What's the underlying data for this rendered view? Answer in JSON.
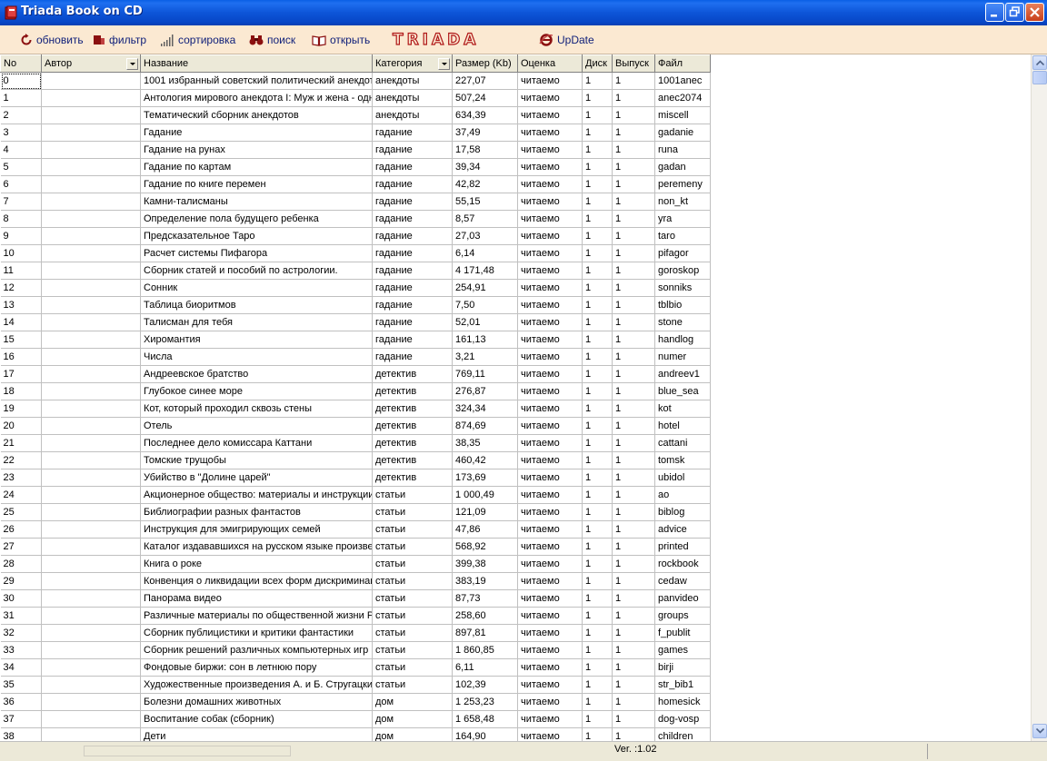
{
  "window": {
    "title": "Triada Book on CD"
  },
  "toolbar": {
    "refresh_label": "обновить",
    "filter_label": "фильтр",
    "sort_label": "сортировка",
    "search_label": "поиск",
    "open_label": "открыть",
    "logo_text": "TRIADA",
    "update_label": "UpDate"
  },
  "colors": {
    "titlebar": "#0a5fe6",
    "toolbar_bg": "#fbe9d2",
    "logo": "#b01818",
    "toolbar_text": "#10207a"
  },
  "table": {
    "columns": [
      "No",
      "Автор",
      "Название",
      "Категория",
      "Размер (Kb)",
      "Оценка",
      "Диск",
      "Выпуск",
      "Файл"
    ],
    "rows": [
      [
        "0",
        "",
        "1001 избранный советский политический анекдот",
        "анекдоты",
        "227,07",
        "читаемо",
        "1",
        "1",
        "1001anec"
      ],
      [
        "1",
        "",
        "Антология мирового анекдота I: Муж и жена - одна сатана",
        "анекдоты",
        "507,24",
        "читаемо",
        "1",
        "1",
        "anec2074"
      ],
      [
        "2",
        "",
        "Тематический сборник анекдотов",
        "анекдоты",
        "634,39",
        "читаемо",
        "1",
        "1",
        "miscell"
      ],
      [
        "3",
        "",
        "Гадание",
        "гадание",
        "37,49",
        "читаемо",
        "1",
        "1",
        "gadanie"
      ],
      [
        "4",
        "",
        "Гадание на рунах",
        "гадание",
        "17,58",
        "читаемо",
        "1",
        "1",
        "runa"
      ],
      [
        "5",
        "",
        "Гадание по картам",
        "гадание",
        "39,34",
        "читаемо",
        "1",
        "1",
        "gadan"
      ],
      [
        "6",
        "",
        "Гадание по книге перемен",
        "гадание",
        "42,82",
        "читаемо",
        "1",
        "1",
        "peremeny"
      ],
      [
        "7",
        "",
        "Камни-талисманы",
        "гадание",
        "55,15",
        "читаемо",
        "1",
        "1",
        "non_kt"
      ],
      [
        "8",
        "",
        "Определение пола будущего ребенка",
        "гадание",
        "8,57",
        "читаемо",
        "1",
        "1",
        "yra"
      ],
      [
        "9",
        "",
        "Предсказательное Таро",
        "гадание",
        "27,03",
        "читаемо",
        "1",
        "1",
        "taro"
      ],
      [
        "10",
        "",
        "Расчет системы Пифагора",
        "гадание",
        "6,14",
        "читаемо",
        "1",
        "1",
        "pifagor"
      ],
      [
        "11",
        "",
        "Сборник статей и пособий по астрологии.",
        "гадание",
        "4 171,48",
        "читаемо",
        "1",
        "1",
        "goroskop"
      ],
      [
        "12",
        "",
        "Сонник",
        "гадание",
        "254,91",
        "читаемо",
        "1",
        "1",
        "sonniks"
      ],
      [
        "13",
        "",
        "Таблица биоритмов",
        "гадание",
        "7,50",
        "читаемо",
        "1",
        "1",
        "tblbio"
      ],
      [
        "14",
        "",
        "Талисман для тебя",
        "гадание",
        "52,01",
        "читаемо",
        "1",
        "1",
        "stone"
      ],
      [
        "15",
        "",
        "Хиромантия",
        "гадание",
        "161,13",
        "читаемо",
        "1",
        "1",
        "handlog"
      ],
      [
        "16",
        "",
        "Числа",
        "гадание",
        "3,21",
        "читаемо",
        "1",
        "1",
        "numer"
      ],
      [
        "17",
        "",
        "Андреевское братство",
        "детектив",
        "769,11",
        "читаемо",
        "1",
        "1",
        "andreev1"
      ],
      [
        "18",
        "",
        "Глубокое синее море",
        "детектив",
        "276,87",
        "читаемо",
        "1",
        "1",
        "blue_sea"
      ],
      [
        "19",
        "",
        "Кот, который проходил сквозь стены",
        "детектив",
        "324,34",
        "читаемо",
        "1",
        "1",
        "kot"
      ],
      [
        "20",
        "",
        "Отель",
        "детектив",
        "874,69",
        "читаемо",
        "1",
        "1",
        "hotel"
      ],
      [
        "21",
        "",
        "Последнее дело комиссара Каттани",
        "детектив",
        "38,35",
        "читаемо",
        "1",
        "1",
        "cattani"
      ],
      [
        "22",
        "",
        "Томские трущобы",
        "детектив",
        "460,42",
        "читаемо",
        "1",
        "1",
        "tomsk"
      ],
      [
        "23",
        "",
        "Убийство в \"Долине царей\"",
        "детектив",
        "173,69",
        "читаемо",
        "1",
        "1",
        "ubidol"
      ],
      [
        "24",
        "",
        "Акционерное общество: материалы и инструкции",
        "статьи",
        "1 000,49",
        "читаемо",
        "1",
        "1",
        "ao"
      ],
      [
        "25",
        "",
        "Библиографии разных фантастов",
        "статьи",
        "121,09",
        "читаемо",
        "1",
        "1",
        "biblog"
      ],
      [
        "26",
        "",
        "Инструкция для эмигрирующих семей",
        "статьи",
        "47,86",
        "читаемо",
        "1",
        "1",
        "advice"
      ],
      [
        "27",
        "",
        "Каталог издававшихся на русском языке произведений",
        "статьи",
        "568,92",
        "читаемо",
        "1",
        "1",
        "printed"
      ],
      [
        "28",
        "",
        "Книга о роке",
        "статьи",
        "399,38",
        "читаемо",
        "1",
        "1",
        "rockbook"
      ],
      [
        "29",
        "",
        "Конвенция о ликвидации всех форм дискриминации",
        "статьи",
        "383,19",
        "читаемо",
        "1",
        "1",
        "cedaw"
      ],
      [
        "30",
        "",
        "Панорама видео",
        "статьи",
        "87,73",
        "читаемо",
        "1",
        "1",
        "panvideo"
      ],
      [
        "31",
        "",
        "Различные материалы по общественной жизни России",
        "статьи",
        "258,60",
        "читаемо",
        "1",
        "1",
        "groups"
      ],
      [
        "32",
        "",
        "Сборник публицистики и критики фантастики",
        "статьи",
        "897,81",
        "читаемо",
        "1",
        "1",
        "f_publit"
      ],
      [
        "33",
        "",
        "Сборник решений различных компьютерных игр и",
        "статьи",
        "1 860,85",
        "читаемо",
        "1",
        "1",
        "games"
      ],
      [
        "34",
        "",
        "Фондовые биржи: сон в летнюю пору",
        "статьи",
        "6,11",
        "читаемо",
        "1",
        "1",
        "birji"
      ],
      [
        "35",
        "",
        "Художественные произведения А. и Б. Стругацких",
        "статьи",
        "102,39",
        "читаемо",
        "1",
        "1",
        "str_bib1"
      ],
      [
        "36",
        "",
        "Болезни домашних животных",
        "дом",
        "1 253,23",
        "читаемо",
        "1",
        "1",
        "homesick"
      ],
      [
        "37",
        "",
        "Воспитание собак (сборник)",
        "дом",
        "1 658,48",
        "читаемо",
        "1",
        "1",
        "dog-vosp"
      ],
      [
        "38",
        "",
        "Дети",
        "дом",
        "164,90",
        "читаемо",
        "1",
        "1",
        "children"
      ]
    ]
  },
  "status": {
    "version": "Ver. :1.02"
  }
}
